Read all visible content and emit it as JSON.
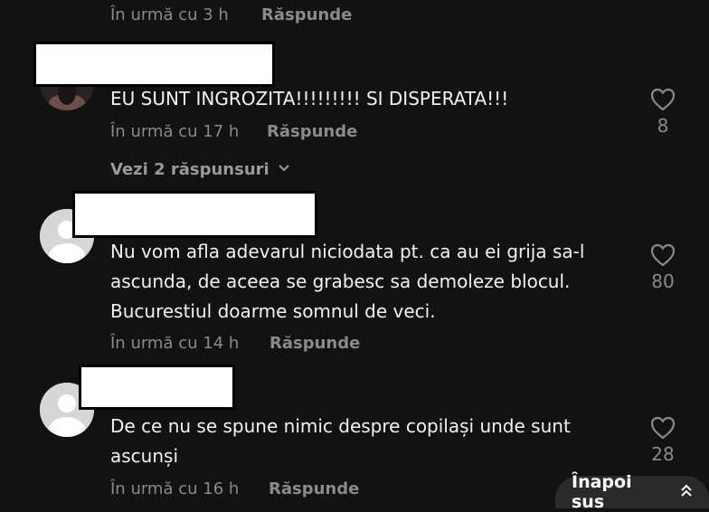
{
  "top_meta": {
    "time": "În urmă cu 3 h",
    "reply": "Răspunde"
  },
  "comments": [
    {
      "text": "EU SUNT INGROZITA!!!!!!!!! SI DISPERATA!!!",
      "time": "În urmă cu 17 h",
      "reply": "Răspunde",
      "likes": "8",
      "view_replies": "Vezi 2 răspunsuri"
    },
    {
      "text": "Nu vom afla adevarul niciodata pt. ca au ei grija sa-l ascunda, de aceea se grabesc sa demoleze blocul. Bucurestiul doarme somnul de veci.",
      "time": "În urmă cu 14 h",
      "reply": "Răspunde",
      "likes": "80"
    },
    {
      "text": "De ce nu se spune nimic despre copilași unde sunt ascunși",
      "time": "În urmă cu 16 h",
      "reply": "Răspunde",
      "likes": "28"
    }
  ],
  "back_to_top": "Înapoi sus",
  "colors": {
    "background": "#121212",
    "muted": "#8a8a8a",
    "text": "#f2f2f2",
    "pill": "#2a2a2a"
  }
}
